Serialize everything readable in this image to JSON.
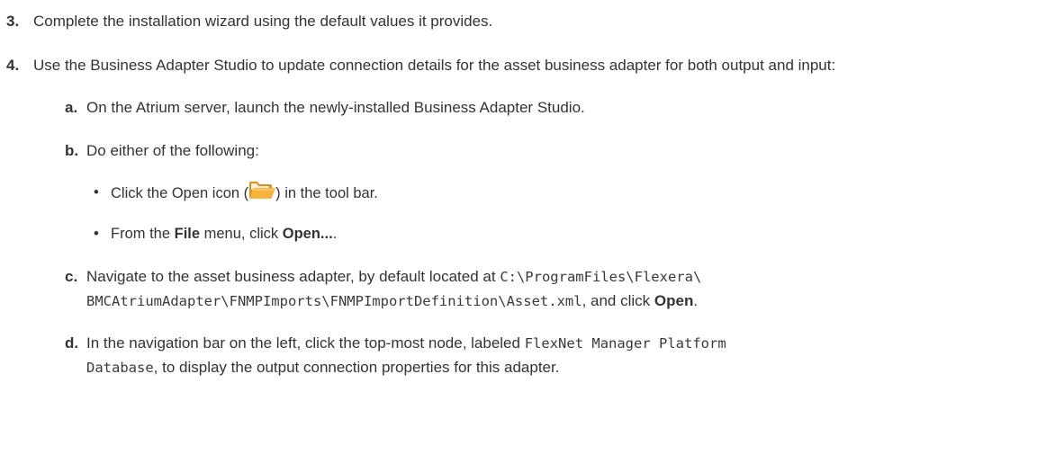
{
  "steps": [
    {
      "number": "3.",
      "text": "Complete the installation wizard using the default values it provides."
    },
    {
      "number": "4.",
      "text": "Use the Business Adapter Studio to update connection details for the asset business adapter for both output and input:",
      "substeps": [
        {
          "letter": "a.",
          "text": "On the Atrium server, launch the newly-installed Business Adapter Studio."
        },
        {
          "letter": "b.",
          "text": "Do either of the following:",
          "bullets": [
            {
              "bullet": "•",
              "before": "Click the Open icon (",
              "icon": "open-folder-icon",
              "after": ") in the tool bar."
            },
            {
              "bullet": "•",
              "before": "From the ",
              "bold1": "File",
              "middle": " menu, click ",
              "bold2": "Open...",
              "after": "."
            }
          ]
        },
        {
          "letter": "c.",
          "before": "Navigate to the asset business adapter, by default located at ",
          "code1": "C:\\ProgramFiles\\Flexera\\",
          "code2": "BMCAtriumAdapter\\FNMPImports\\FNMPImportDefinition\\Asset.xml",
          "middle": ", and click ",
          "bold": "Open",
          "after": "."
        },
        {
          "letter": "d.",
          "before": "In the navigation bar on the left, click the top-most node, labeled ",
          "code1": "FlexNet Manager Platform",
          "code2": "Database",
          "after": ", to display the output connection properties for this adapter."
        }
      ]
    }
  ],
  "colors": {
    "text": "#333333",
    "folder": "#f0a630"
  }
}
